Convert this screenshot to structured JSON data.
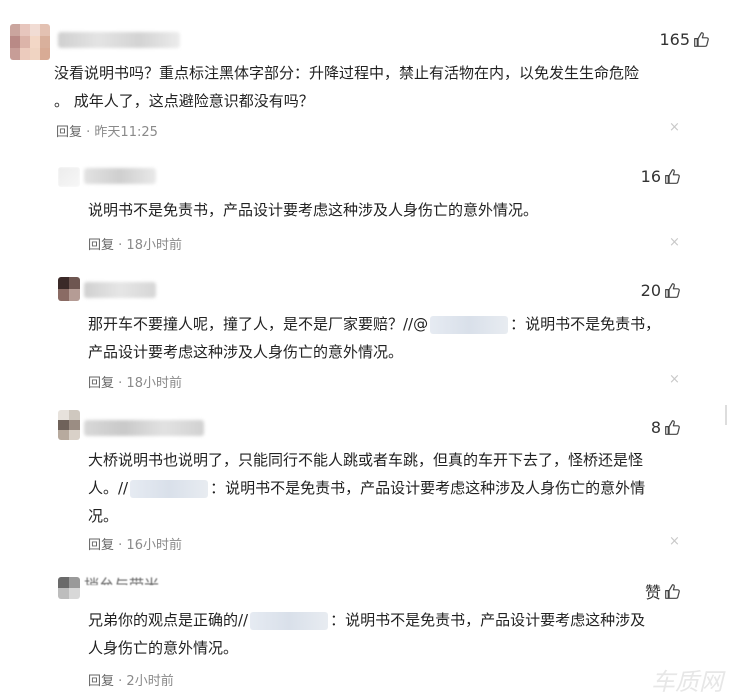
{
  "comments": [
    {
      "likes": "165",
      "text1": "没看说明书吗？重点标注黑体字部分：升降过程中，禁止有活物在内，以免发生生命危险",
      "text2": "。 成年人了，这点避险意识都没有吗？",
      "reply": "回复",
      "time": "· 昨天11:25"
    },
    {
      "likes": "16",
      "text1": "说明书不是免责书，产品设计要考虑这种涉及人身伤亡的意外情况。",
      "reply": "回复",
      "time": "· 18小时前"
    },
    {
      "likes": "20",
      "text1_a": "那开车不要撞人呢，撞了人，是不是厂家要赔？//@",
      "text1_b": "：说明书不是免责书，",
      "text2": "产品设计要考虑这种涉及人身伤亡的意外情况。",
      "reply": "回复",
      "time": "· 18小时前"
    },
    {
      "likes": "8",
      "text1": "大桥说明书也说明了，只能同行不能人跳或者车跳，但真的车开下去了，怪桥还是怪",
      "text2_a": "人。//",
      "text2_b": "：说明书不是免责书，产品设计要考虑这种涉及人身伤亡的意外情",
      "text3": "况。",
      "reply": "回复",
      "time": "· 16小时前"
    },
    {
      "likes": "赞",
      "name_partial": "捎允与带米",
      "text1_a": "兄弟你的观点是正确的//",
      "text1_b": "：说明书不是免责书，产品设计要考虑这种涉及",
      "text2": "人身伤亡的意外情况。",
      "reply": "回复",
      "time": "· 2小时前"
    }
  ],
  "close_glyph": "×",
  "watermark": "车质网",
  "colors": {
    "text": "#222222",
    "meta": "#8a8a8a",
    "close": "#c8c8c8"
  }
}
